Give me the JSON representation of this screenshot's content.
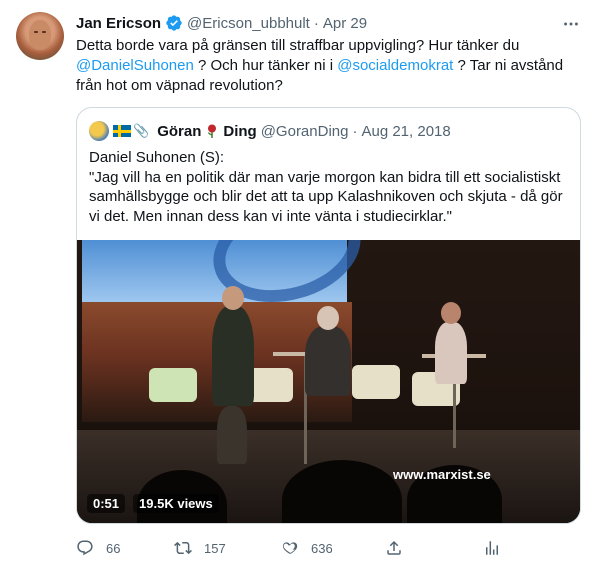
{
  "tweet": {
    "author_name": "Jan Ericson",
    "handle": "@Ericson_ubbhult",
    "separator": "·",
    "date": "Apr 29",
    "text_parts": {
      "p1": "Detta borde vara på gränsen till straffbar uppvigling? Hur tänker du ",
      "m1": "@DanielSuhonen",
      "p2": " ? Och hur tänker ni i ",
      "m2": "@socialdemokrat",
      "p3": " ? Tar ni avstånd från hot om väpnad revolution?"
    }
  },
  "quote": {
    "author_name": "Göran",
    "author_name_2": "Ding",
    "handle": "@GoranDing",
    "separator": "·",
    "date": "Aug 21, 2018",
    "line1": "Daniel Suhonen (S):",
    "body": "\"Jag vill ha en politik där man varje morgon kan bidra till ett socialistiskt samhällsbygge och blir det att ta upp Kalashnikoven och skjuta - då gör vi det. Men innan dess kan vi inte vänta i studiecirklar.\"",
    "video": {
      "watermark": "www.marxist.se",
      "duration": "0:51",
      "views": "19.5K views"
    }
  },
  "actions": {
    "reply_count": "66",
    "retweet_count": "157",
    "like_count": "636"
  },
  "icons": {
    "verified": "verified-badge-icon",
    "more": "more-dots-icon",
    "reply": "reply-icon",
    "retweet": "retweet-icon",
    "like": "heart-icon",
    "share": "share-icon",
    "analytics": "analytics-icon"
  },
  "colors": {
    "accent": "#1d9bf0",
    "text": "#0f1419",
    "muted": "#536471",
    "border": "#cfd9de"
  }
}
